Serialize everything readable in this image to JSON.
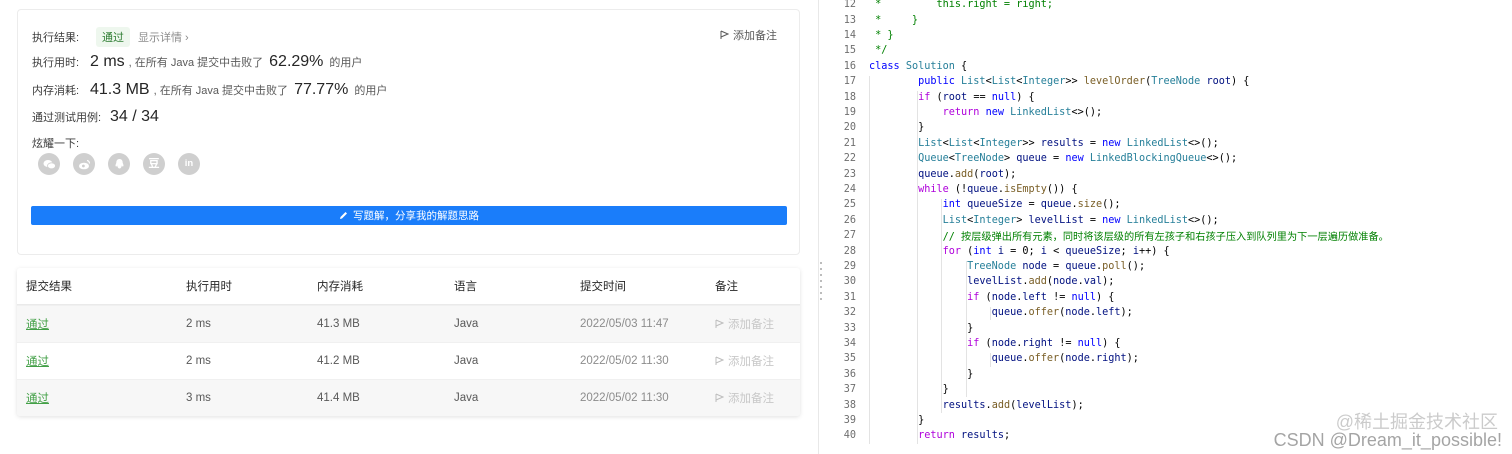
{
  "summary": {
    "result_label": "执行结果:",
    "result_status": "通过",
    "show_details": "显示详情 ›",
    "add_note": "添加备注",
    "runtime_label": "执行用时:",
    "runtime_value": "2 ms",
    "runtime_text": ", 在所有 Java 提交中击败了",
    "runtime_pct": "62.29%",
    "runtime_suffix": "的用户",
    "memory_label": "内存消耗:",
    "memory_value": "41.3 MB",
    "memory_text": ", 在所有 Java 提交中击败了",
    "memory_pct": "77.77%",
    "memory_suffix": "的用户",
    "tests_label": "通过测试用例:",
    "tests_value": "34 / 34",
    "share_label": "炫耀一下:",
    "share_icons": [
      "wechat-icon",
      "weibo-icon",
      "qq-icon",
      "douban-icon",
      "linkedin-icon"
    ],
    "write_button": "写题解，分享我的解题思路"
  },
  "table": {
    "headers": [
      "提交结果",
      "执行用时",
      "内存消耗",
      "语言",
      "提交时间",
      "备注"
    ],
    "rows": [
      {
        "status": "通过",
        "runtime": "2 ms",
        "memory": "41.3 MB",
        "lang": "Java",
        "time": "2022/05/03 11:47",
        "note": "添加备注"
      },
      {
        "status": "通过",
        "runtime": "2 ms",
        "memory": "41.2 MB",
        "lang": "Java",
        "time": "2022/05/02 11:30",
        "note": "添加备注"
      },
      {
        "status": "通过",
        "runtime": "3 ms",
        "memory": "41.4 MB",
        "lang": "Java",
        "time": "2022/05/02 11:30",
        "note": "添加备注"
      }
    ]
  },
  "code": {
    "lines": [
      {
        "n": "12",
        "t": " *         this.right = right;"
      },
      {
        "n": "13",
        "t": " *     }"
      },
      {
        "n": "14",
        "t": " * }"
      },
      {
        "n": "15",
        "t": " */"
      },
      {
        "n": "16",
        "t": "class Solution {"
      },
      {
        "n": "17",
        "t": "        public List<List<Integer>> levelOrder(TreeNode root) {"
      },
      {
        "n": "18",
        "t": "        if (root == null) {"
      },
      {
        "n": "19",
        "t": "            return new LinkedList<>();"
      },
      {
        "n": "20",
        "t": "        }"
      },
      {
        "n": "21",
        "t": "        List<List<Integer>> results = new LinkedList<>();"
      },
      {
        "n": "22",
        "t": "        Queue<TreeNode> queue = new LinkedBlockingQueue<>();"
      },
      {
        "n": "23",
        "t": "        queue.add(root);"
      },
      {
        "n": "24",
        "t": "        while (!queue.isEmpty()) {"
      },
      {
        "n": "25",
        "t": "            int queueSize = queue.size();"
      },
      {
        "n": "26",
        "t": "            List<Integer> levelList = new LinkedList<>();"
      },
      {
        "n": "27",
        "t": "            // 按层级弹出所有元素，同时将该层级的所有左孩子和右孩子压入到队列里为下一层遍历做准备。"
      },
      {
        "n": "28",
        "t": "            for (int i = 0; i < queueSize; i++) {"
      },
      {
        "n": "29",
        "t": "                TreeNode node = queue.poll();"
      },
      {
        "n": "30",
        "t": "                levelList.add(node.val);"
      },
      {
        "n": "31",
        "t": "                if (node.left != null) {"
      },
      {
        "n": "32",
        "t": "                    queue.offer(node.left);"
      },
      {
        "n": "33",
        "t": "                }"
      },
      {
        "n": "34",
        "t": "                if (node.right != null) {"
      },
      {
        "n": "35",
        "t": "                    queue.offer(node.right);"
      },
      {
        "n": "36",
        "t": "                }"
      },
      {
        "n": "37",
        "t": "            }"
      },
      {
        "n": "38",
        "t": "            results.add(levelList);"
      },
      {
        "n": "39",
        "t": "        }"
      },
      {
        "n": "40",
        "t": "        return results;"
      }
    ]
  },
  "watermark": {
    "line1": "@稀土掘金技术社区",
    "line2": "CSDN @Dream_it_possible!"
  }
}
